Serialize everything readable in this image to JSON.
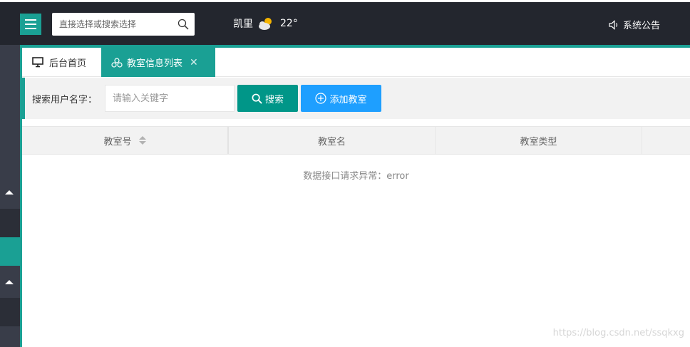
{
  "header": {
    "search_placeholder": "直接选择或搜索选择",
    "city": "凯里",
    "temperature": "22°",
    "weather_icon": "partly-cloudy-icon",
    "announcement": "系统公告"
  },
  "tabs": [
    {
      "label": "后台首页",
      "icon": "monitor-icon"
    },
    {
      "label": "教室信息列表",
      "icon": "cluster-icon",
      "active": true
    }
  ],
  "toolbar": {
    "search_label": "搜索用户名字：",
    "keyword_placeholder": "请输入关键字",
    "search_button": "搜索",
    "add_button": "添加教室"
  },
  "table": {
    "columns": [
      "教室号",
      "教室名",
      "教室类型"
    ],
    "empty_message": "数据接口请求异常：error"
  },
  "watermark": "https://blog.csdn.net/ssqkxg",
  "colors": {
    "accent": "#1aa094",
    "topbar": "#23262e",
    "sidebar": "#393d49",
    "search_button": "#009688",
    "add_button": "#1e9fff"
  }
}
